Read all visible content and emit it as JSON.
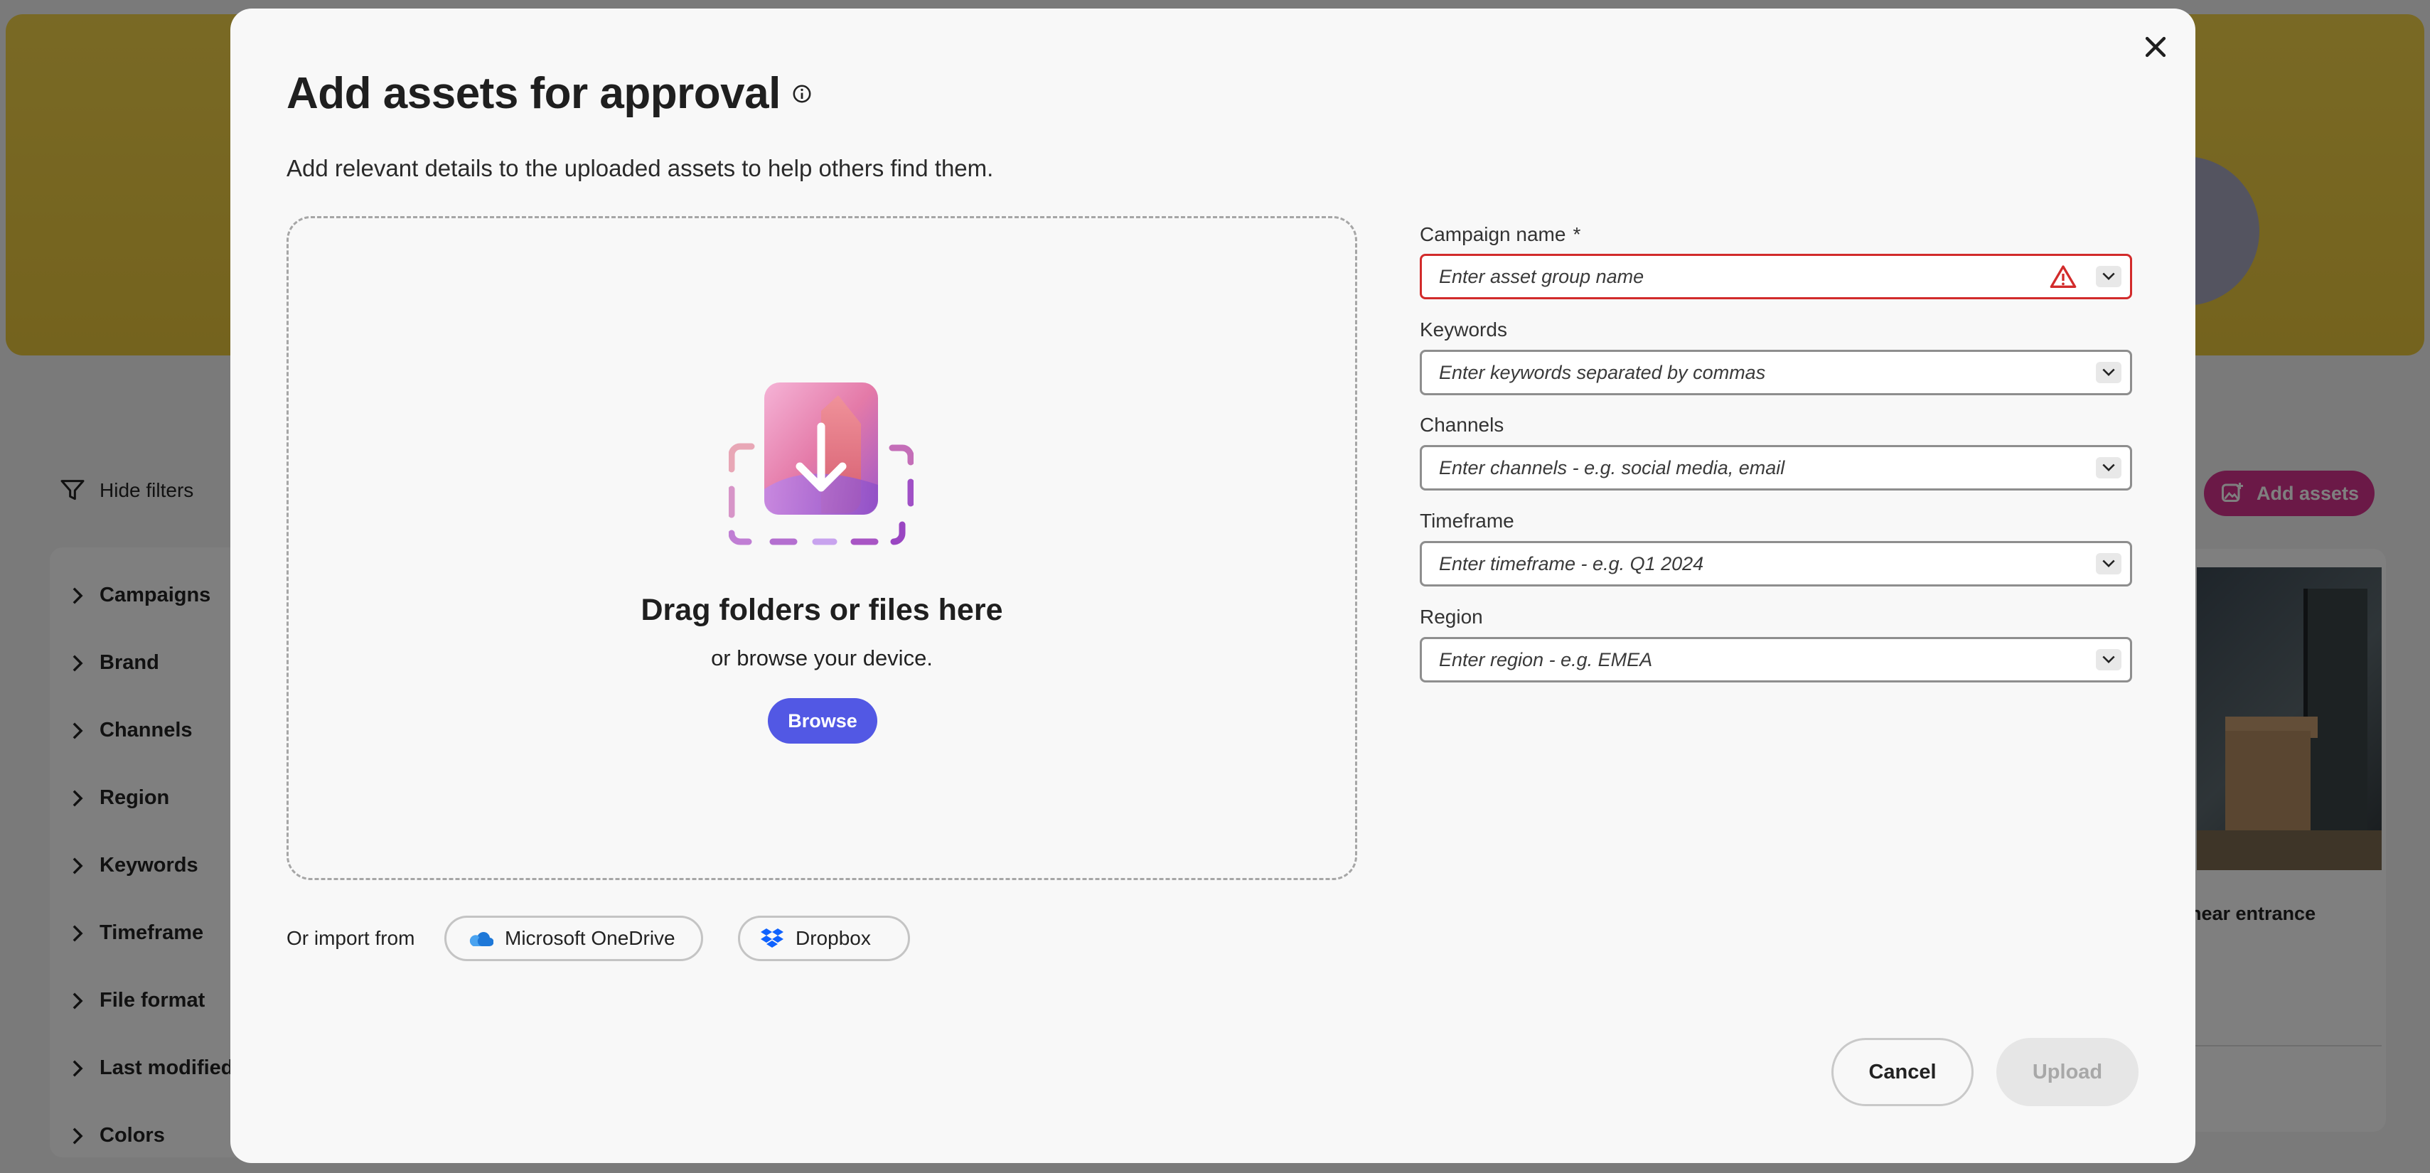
{
  "background": {
    "hide_filters_label": "Hide filters",
    "add_assets_label": "Add assets",
    "filters": [
      "Campaigns",
      "Brand",
      "Channels",
      "Region",
      "Keywords",
      "Timeframe",
      "File format",
      "Last modified",
      "Colors"
    ],
    "card_title": "near entrance",
    "accent_color": "#d6338f"
  },
  "modal": {
    "title": "Add assets for approval",
    "subtitle": "Add relevant details to the uploaded assets to help others find them.",
    "dropzone": {
      "title": "Drag folders or files here",
      "subtitle": "or browse your device.",
      "browse_label": "Browse"
    },
    "import": {
      "label": "Or import from",
      "onedrive_label": "Microsoft OneDrive",
      "dropbox_label": "Dropbox"
    },
    "fields": [
      {
        "label": "Campaign name",
        "required_mark": "*",
        "placeholder": "Enter asset group name",
        "error": true
      },
      {
        "label": "Keywords",
        "placeholder": "Enter keywords separated by commas"
      },
      {
        "label": "Channels",
        "placeholder": "Enter channels - e.g. social media, email"
      },
      {
        "label": "Timeframe",
        "placeholder": "Enter timeframe - e.g. Q1 2024"
      },
      {
        "label": "Region",
        "placeholder": "Enter region - e.g. EMEA"
      }
    ],
    "cancel_label": "Cancel",
    "upload_label": "Upload",
    "primary_color": "#5258e4",
    "error_color": "#d22b2b"
  }
}
